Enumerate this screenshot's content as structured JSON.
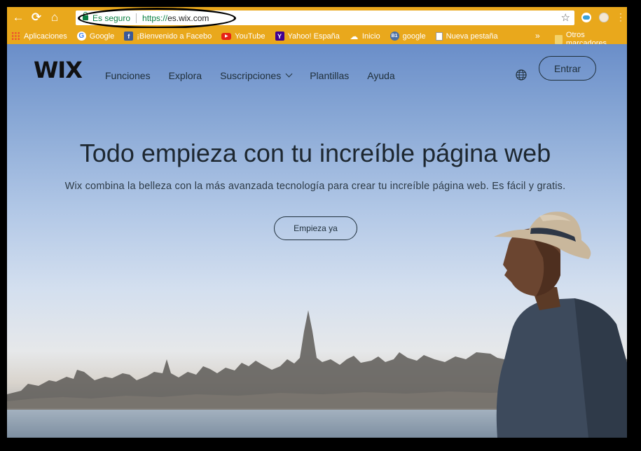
{
  "browser": {
    "security_label": "Es seguro",
    "url_scheme": "https://",
    "url_host": "es.wix.com",
    "bookmarks": [
      {
        "label": "Aplicaciones",
        "icon": "apps-grid-icon"
      },
      {
        "label": "Google",
        "icon": "google-icon"
      },
      {
        "label": "¡Bienvenido a Facebo",
        "icon": "facebook-icon"
      },
      {
        "label": "YouTube",
        "icon": "youtube-icon"
      },
      {
        "label": "Yahoo! España",
        "icon": "yahoo-icon"
      },
      {
        "label": "Inicio",
        "icon": "cloud-icon"
      },
      {
        "label": "google",
        "icon": "b1-icon"
      },
      {
        "label": "Nueva pestaña",
        "icon": "page-icon"
      }
    ],
    "overflow_chevron": "»",
    "other_bookmarks": "Otros marcadores"
  },
  "site": {
    "logo": "WIX",
    "nav": [
      "Funciones",
      "Explora",
      "Suscripciones",
      "Plantillas",
      "Ayuda"
    ],
    "login_label": "Entrar",
    "headline": "Todo empieza con tu increíble página web",
    "subheadline": "Wix combina la belleza con la más avanzada tecnología para crear tu increíble página web. Es fácil y gratis.",
    "cta_label": "Empieza ya"
  },
  "colors": {
    "chrome_bar": "#e9a81c",
    "secure_green": "#0b8043",
    "text_dark": "#20303c"
  }
}
